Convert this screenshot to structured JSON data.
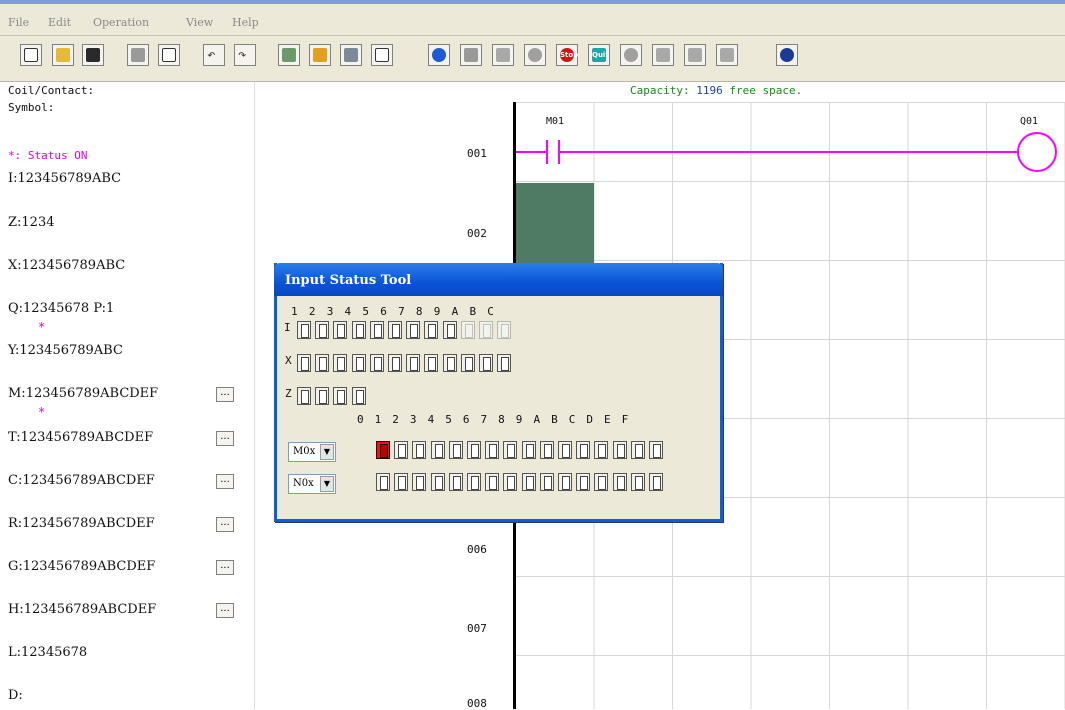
{
  "menu": {
    "file": "File",
    "edit": "Edit",
    "operation": "Operation",
    "view": "View",
    "help": "Help"
  },
  "toolbar": {
    "icons": [
      "new-icon",
      "open-icon",
      "save-icon",
      "print-icon",
      "print-preview-icon",
      "undo-icon",
      "redo-icon",
      "monitor-icon",
      "ladder-icon",
      "function-block-icon",
      "text-icon",
      "connect-icon",
      "read-icon",
      "write-icon",
      "simulate-icon",
      "stop-icon",
      "quit-icon",
      "run-icon",
      "monitor-off-icon",
      "upload-icon",
      "download-icon",
      "help-icon"
    ],
    "stop_label": "Stop",
    "quit_label": "Quit"
  },
  "left_panel": {
    "coil_contact": "Coil/Contact:",
    "symbol": "Symbol:",
    "status_on": "*: Status ON",
    "rows": [
      {
        "id": "I",
        "text": "I:123456789ABC",
        "more": false
      },
      {
        "id": "Z",
        "text": "Z:1234",
        "more": false
      },
      {
        "id": "X",
        "text": "X:123456789ABC",
        "more": false
      },
      {
        "id": "Q",
        "text": "Q:12345678 P:1",
        "more": false
      },
      {
        "id": "Y",
        "text": "Y:123456789ABC",
        "more": false
      },
      {
        "id": "M",
        "text": "M:123456789ABCDEF",
        "more": true
      },
      {
        "id": "T",
        "text": "T:123456789ABCDEF",
        "more": true
      },
      {
        "id": "C",
        "text": "C:123456789ABCDEF",
        "more": true
      },
      {
        "id": "R",
        "text": "R:123456789ABCDEF",
        "more": true
      },
      {
        "id": "G",
        "text": "G:123456789ABCDEF",
        "more": true
      },
      {
        "id": "H",
        "text": "H:123456789ABCDEF",
        "more": true
      },
      {
        "id": "L",
        "text": "L:12345678",
        "more": false
      },
      {
        "id": "D",
        "text": "D:",
        "more": false
      }
    ],
    "more_label": "..."
  },
  "capacity": {
    "label": "Capacity:",
    "value": "1196",
    "suffix": "free space."
  },
  "ladder": {
    "line_numbers": [
      "001",
      "002",
      "006",
      "007",
      "008"
    ],
    "contact_label": "M01",
    "coil_label": "Q01"
  },
  "dialog": {
    "title": "Input Status Tool",
    "i_header": "1 2 3 4 5 6 7 8 9 A B C",
    "i_label": "I",
    "x_label": "X",
    "z_label": "Z",
    "m_header": "0 1 2 3 4 5 6 7 8 9 A B C D E F",
    "m_select": "M0x",
    "n_select": "N0x"
  },
  "colors": {
    "wire": "#ff00ff",
    "titlebar": "#0a54d6",
    "cursor": "#4f7a63",
    "capacity": "#148d14"
  }
}
